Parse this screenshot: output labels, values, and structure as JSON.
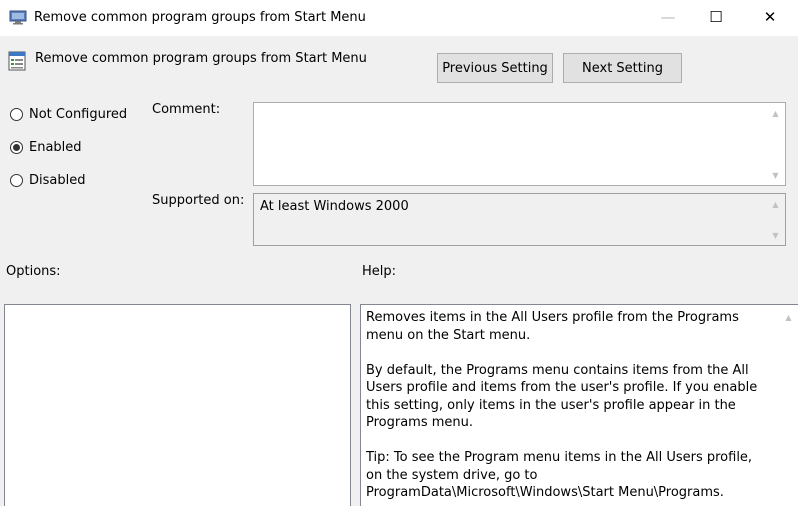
{
  "window": {
    "title": "Remove common program groups from Start Menu",
    "controls": {
      "minimize": "—",
      "maximize": "☐",
      "close": "✕"
    }
  },
  "setting": {
    "name": "Remove common program groups from Start Menu",
    "prev_label": "Previous Setting",
    "next_label": "Next Setting"
  },
  "state": {
    "options": [
      {
        "label": "Not Configured",
        "checked": false
      },
      {
        "label": "Enabled",
        "checked": true
      },
      {
        "label": "Disabled",
        "checked": false
      }
    ]
  },
  "comment": {
    "label": "Comment:",
    "value": ""
  },
  "supported": {
    "label": "Supported on:",
    "value": "At least Windows 2000"
  },
  "options_section": {
    "label": "Options:"
  },
  "help": {
    "label": "Help:",
    "paragraphs": [
      "Removes items in the All Users profile from the Programs menu on the Start menu.",
      "By default, the Programs menu contains items from the All Users profile and items from the user's profile. If you enable this setting, only items in the user's profile appear in the Programs menu.",
      "Tip: To see the Program menu items in the All Users profile, on the system drive, go to ProgramData\\Microsoft\\Windows\\Start Menu\\Programs."
    ]
  }
}
